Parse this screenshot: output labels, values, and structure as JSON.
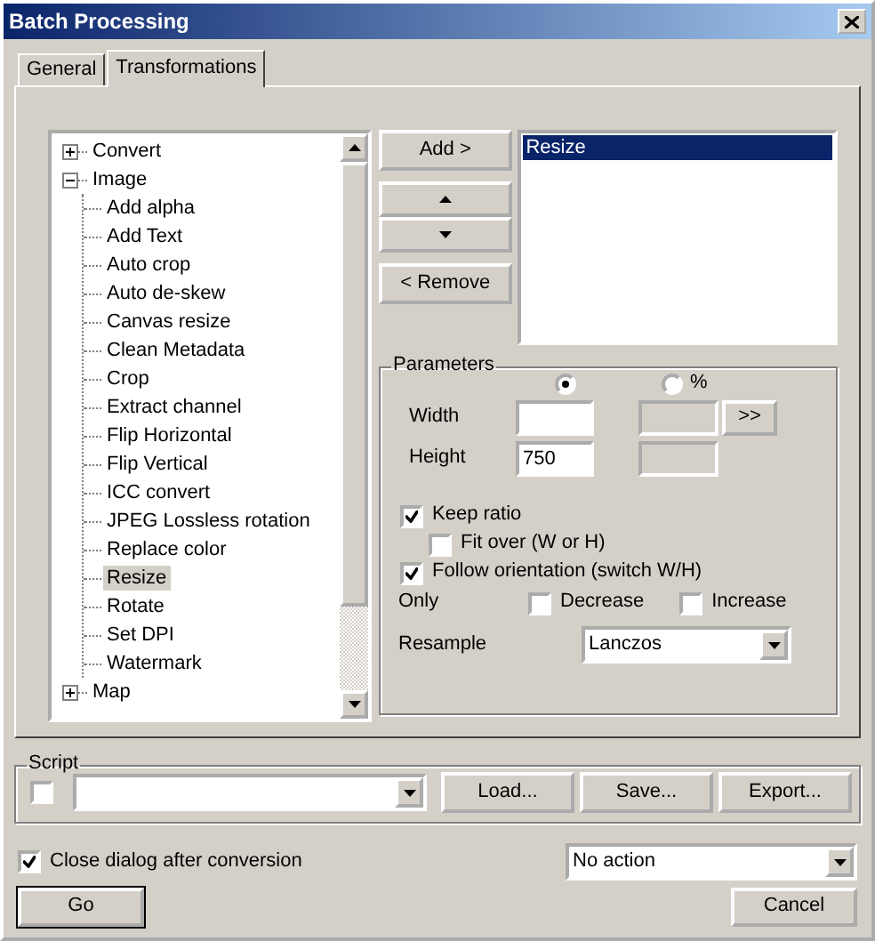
{
  "window": {
    "title": "Batch Processing"
  },
  "tabs": [
    {
      "label": "General",
      "selected": false
    },
    {
      "label": "Transformations",
      "selected": true
    }
  ],
  "tree": [
    {
      "label": "Convert",
      "expanded": false,
      "selected": false
    },
    {
      "label": "Image",
      "expanded": true,
      "selected": false,
      "children": [
        {
          "label": "Add alpha",
          "selected": false
        },
        {
          "label": "Add Text",
          "selected": false
        },
        {
          "label": "Auto crop",
          "selected": false
        },
        {
          "label": "Auto de-skew",
          "selected": false
        },
        {
          "label": "Canvas resize",
          "selected": false
        },
        {
          "label": "Clean Metadata",
          "selected": false
        },
        {
          "label": "Crop",
          "selected": false
        },
        {
          "label": "Extract channel",
          "selected": false
        },
        {
          "label": "Flip Horizontal",
          "selected": false
        },
        {
          "label": "Flip Vertical",
          "selected": false
        },
        {
          "label": "ICC convert",
          "selected": false
        },
        {
          "label": "JPEG Lossless rotation",
          "selected": false
        },
        {
          "label": "Replace color",
          "selected": false
        },
        {
          "label": "Resize",
          "selected": true
        },
        {
          "label": "Rotate",
          "selected": false
        },
        {
          "label": "Set DPI",
          "selected": false
        },
        {
          "label": "Watermark",
          "selected": false
        }
      ]
    },
    {
      "label": "Map",
      "expanded": false,
      "selected": false
    }
  ],
  "transform_buttons": {
    "add": "Add >",
    "remove": "< Remove"
  },
  "transform_list": [
    {
      "label": "Resize",
      "selected": true
    }
  ],
  "parameters": {
    "title": "Parameters",
    "units": [
      {
        "selected": true
      },
      {
        "label": "%",
        "selected": false
      }
    ],
    "width": {
      "label": "Width",
      "percent_disabled": true
    },
    "height": {
      "label": "Height",
      "value": "750",
      "percent_disabled": true
    },
    "expand_button": ">>",
    "options": [
      {
        "label": "Keep ratio",
        "checked": true,
        "children": [
          {
            "label": "Fit over (W or H)",
            "checked": false
          }
        ]
      },
      {
        "label": "Follow orientation (switch W/H)",
        "checked": true
      }
    ],
    "only": {
      "label": "Only",
      "options": [
        {
          "label": "Decrease",
          "checked": false
        },
        {
          "label": "Increase",
          "checked": false
        }
      ]
    },
    "resample": {
      "label": "Resample",
      "value": "Lanczos"
    }
  },
  "script": {
    "title": "Script",
    "enabled": false,
    "buttons": [
      "Load...",
      "Save...",
      "Export..."
    ]
  },
  "close_after": {
    "label": "Close dialog after conversion",
    "checked": true
  },
  "after_action": {
    "value": "No action"
  },
  "footer_buttons": [
    {
      "label": "Go",
      "default": true
    },
    {
      "label": "Cancel",
      "default": false
    }
  ]
}
